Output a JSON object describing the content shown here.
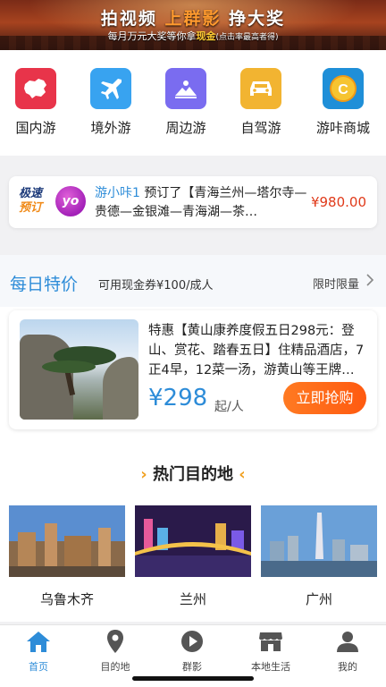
{
  "banner": {
    "title_a": "拍视频",
    "title_b": "上群影",
    "title_c": "挣大奖",
    "sub_a": "每月万元大奖等你拿",
    "sub_b": "现金",
    "sub_c": "(点击率最高者得)"
  },
  "categories": [
    {
      "label": "国内游",
      "icon": "china-map-icon",
      "color": "#e8344a"
    },
    {
      "label": "境外游",
      "icon": "airplane-icon",
      "color": "#38a3f0"
    },
    {
      "label": "周边游",
      "icon": "mountain-icon",
      "color": "#7a6cf0"
    },
    {
      "label": "自驾游",
      "icon": "car-icon",
      "color": "#f2b431"
    },
    {
      "label": "游咔商城",
      "icon": "coin-icon",
      "color": "#1f8fd8"
    }
  ],
  "promo": {
    "speed_a": "极速",
    "speed_b": "预订",
    "avatar": "yo",
    "user": "游小咔1",
    "text": " 预订了【青海兰州—塔尔寺—贵德—金银滩—青海湖—茶…",
    "price": "¥980.00"
  },
  "daily": {
    "title": "每日特价",
    "subtitle": "可用现金券¥100/成人",
    "limit": "限时限量",
    "deal_desc": "特惠【黄山康养度假五日298元：登山、赏花、踏春五日】住精品酒店，7正4早，12菜一汤，游黄山等王牌…",
    "price": "¥298",
    "price_unit": "起/人",
    "buy_label": "立即抢购"
  },
  "hot": {
    "title": "热门目的地",
    "destinations": [
      {
        "name": "乌鲁木齐"
      },
      {
        "name": "兰州"
      },
      {
        "name": "广州"
      }
    ]
  },
  "tabs": [
    {
      "label": "首页"
    },
    {
      "label": "目的地"
    },
    {
      "label": "群影"
    },
    {
      "label": "本地生活"
    },
    {
      "label": "我的"
    }
  ],
  "colors": {
    "accent": "#2d8cd8",
    "price_red": "#e03a1a",
    "buy_orange": "#ff6a18"
  }
}
